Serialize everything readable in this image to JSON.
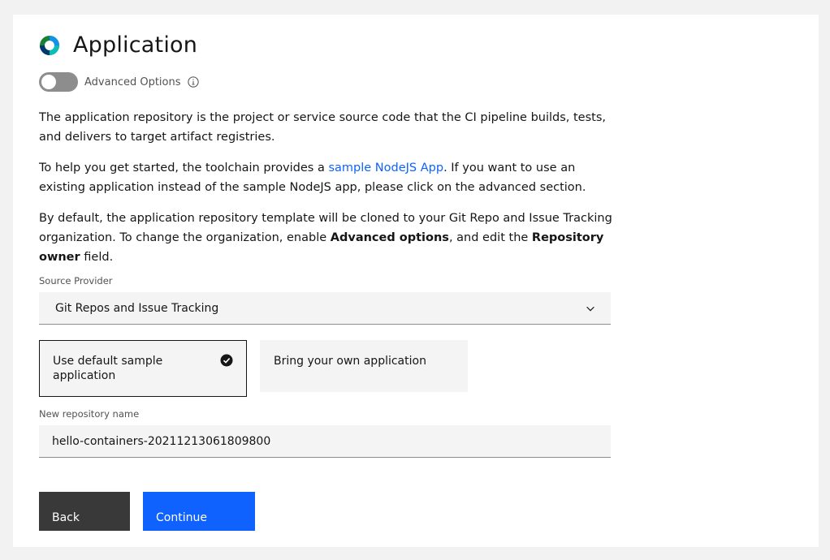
{
  "header": {
    "title": "Application",
    "logo_icon": "toolchain-ring-logo-icon"
  },
  "advanced_toggle": {
    "label": "Advanced Options",
    "state": "off",
    "info_icon": "info-icon"
  },
  "description": {
    "p1": "The application repository is the project or service source code that the CI pipeline builds, tests, and delivers to target artifact registries.",
    "p2_before": "To help you get started, the toolchain provides a ",
    "p2_link": "sample NodeJS App",
    "p2_after": ". If you want to use an existing application instead of the sample NodeJS app, please click on the advanced section.",
    "p3_a": "By default, the application repository template will be cloned to your Git Repo and Issue Tracking organization. To change the organization, enable ",
    "p3_bold1": "Advanced options",
    "p3_b": ", and edit the ",
    "p3_bold2": "Repository owner",
    "p3_c": " field."
  },
  "source_provider": {
    "label": "Source Provider",
    "value": "Git Repos and Issue Tracking"
  },
  "tiles": {
    "default": {
      "label": "Use default sample application",
      "selected": true
    },
    "own": {
      "label": "Bring your own application",
      "selected": false
    }
  },
  "repo_name": {
    "label": "New repository name",
    "value": "hello-containers-20211213061809800"
  },
  "buttons": {
    "back": "Back",
    "continue": "Continue"
  },
  "colors": {
    "primary": "#0f62fe",
    "secondary_button": "#393939",
    "toggle_off": "#8d8d8d"
  }
}
